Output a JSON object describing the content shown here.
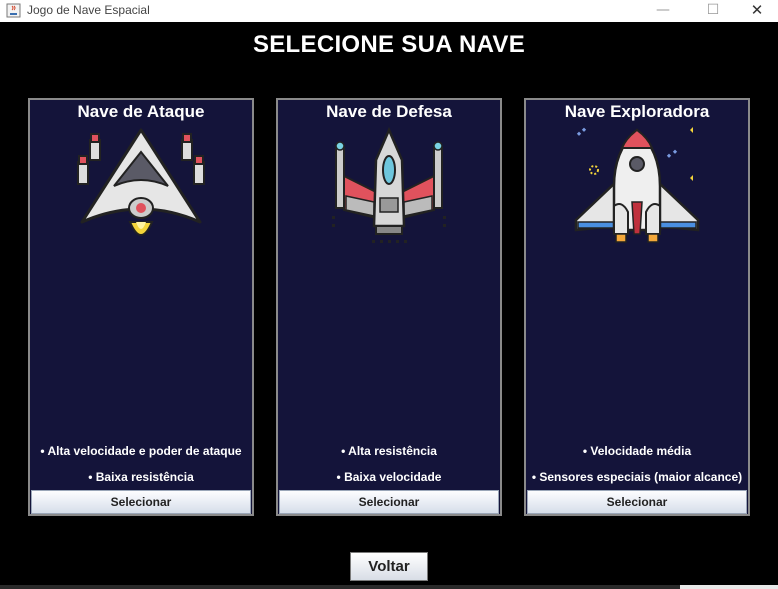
{
  "window": {
    "title": "Jogo de Nave Espacial",
    "controls": {
      "minimize": "—",
      "maximize": "☐",
      "close": "✕"
    }
  },
  "page": {
    "title": "SELECIONE SUA NAVE"
  },
  "ships": [
    {
      "name": "Nave de Ataque",
      "icon": "attack-ship-icon",
      "features": [
        "• Alta velocidade e poder de ataque",
        "• Baixa resistência"
      ],
      "button": "Selecionar"
    },
    {
      "name": "Nave de Defesa",
      "icon": "defense-ship-icon",
      "features": [
        "• Alta resistência",
        "• Baixa velocidade"
      ],
      "button": "Selecionar"
    },
    {
      "name": "Nave Exploradora",
      "icon": "explorer-ship-icon",
      "features": [
        "• Velocidade média",
        "• Sensores especiais (maior alcance)"
      ],
      "button": "Selecionar"
    }
  ],
  "footer": {
    "back_button": "Voltar"
  },
  "colors": {
    "background": "#000000",
    "card": "#14143a",
    "card_border": "#8a8a8a",
    "text": "#ffffff"
  }
}
